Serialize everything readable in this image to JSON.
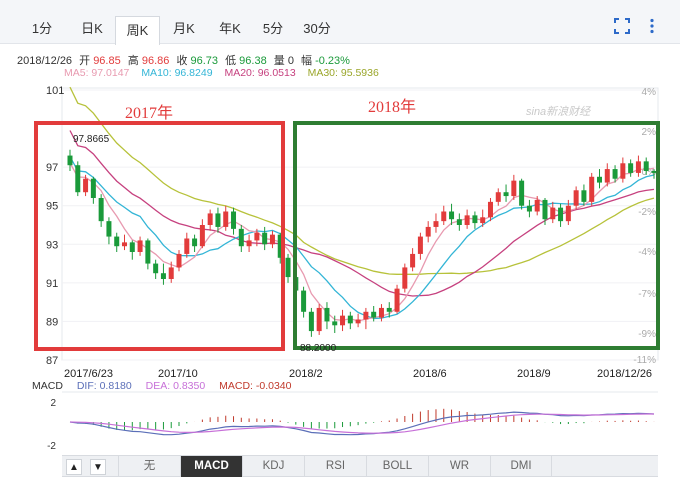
{
  "tabs": [
    {
      "label": "1分"
    },
    {
      "label": "日K"
    },
    {
      "label": "周K"
    },
    {
      "label": "月K"
    },
    {
      "label": "年K"
    },
    {
      "label": "5分"
    },
    {
      "label": "30分"
    }
  ],
  "active_tab": "周K",
  "toolbar_icons": [
    "fullscreen-icon",
    "more-vertical-icon"
  ],
  "quote": {
    "date": "2018/12/26",
    "open_label": "开",
    "open": "96.85",
    "high_label": "高",
    "high": "96.86",
    "close_label": "收",
    "close": "96.73",
    "low_label": "低",
    "low": "96.38",
    "volume_label": "量",
    "volume": "0",
    "change_label": "幅",
    "change": "-0.23%"
  },
  "ma": {
    "ma5": "MA5: 97.0147",
    "ma10": "MA10: 96.8249",
    "ma20": "MA20: 96.0513",
    "ma30": "MA30: 95.5936"
  },
  "colors": {
    "ma5": "#e89ab0",
    "ma10": "#33b5d6",
    "ma20": "#c6417f",
    "ma30": "#b7c23a",
    "up": "#e23b3b",
    "down": "#1a9a3a",
    "box2017": "#e23b3b",
    "box2018": "#2e7d32",
    "dif": "#5b6fb8",
    "dea": "#c770d8",
    "macd": "#c0392b"
  },
  "annotations": {
    "label_2017": "2017年",
    "label_2018": "2018年",
    "peak_marker": "97.8665",
    "low_marker": "88.2000",
    "watermark": "sina新浪财经"
  },
  "chart_data": {
    "type": "candlestick",
    "ylim": [
      87,
      101
    ],
    "left_axis_ticks": [
      "101",
      "97",
      "95",
      "93",
      "91",
      "89",
      "87"
    ],
    "right_axis_ticks": [
      "4%",
      "2%",
      "0%",
      "-2%",
      "-4%",
      "-7%",
      "-9%",
      "-11%"
    ],
    "x_labels": [
      "2017/6/23",
      "2017/10",
      "2018/2",
      "2018/6",
      "2018/9",
      "2018/12/26"
    ],
    "candles": [
      [
        97.6,
        97.1,
        97.9,
        96.8
      ],
      [
        97.1,
        95.7,
        97.3,
        95.5
      ],
      [
        95.7,
        96.4,
        96.6,
        95.5
      ],
      [
        96.4,
        95.4,
        96.5,
        95.1
      ],
      [
        95.4,
        94.2,
        95.6,
        93.9
      ],
      [
        94.2,
        93.4,
        94.4,
        93.0
      ],
      [
        93.4,
        92.9,
        93.6,
        92.6
      ],
      [
        92.9,
        93.1,
        93.5,
        92.7
      ],
      [
        93.1,
        92.6,
        93.2,
        92.2
      ],
      [
        92.6,
        93.2,
        93.4,
        92.4
      ],
      [
        93.2,
        92.0,
        93.3,
        91.7
      ],
      [
        92.0,
        91.5,
        92.2,
        91.2
      ],
      [
        91.5,
        91.2,
        92.0,
        90.9
      ],
      [
        91.2,
        91.8,
        92.1,
        91.0
      ],
      [
        91.8,
        92.5,
        92.7,
        91.6
      ],
      [
        92.5,
        93.3,
        93.6,
        92.3
      ],
      [
        93.3,
        92.9,
        93.5,
        92.6
      ],
      [
        92.9,
        94.0,
        94.3,
        92.8
      ],
      [
        94.0,
        94.6,
        94.8,
        93.7
      ],
      [
        94.6,
        93.9,
        94.9,
        93.6
      ],
      [
        93.9,
        94.7,
        95.0,
        93.7
      ],
      [
        94.7,
        93.8,
        94.9,
        93.5
      ],
      [
        93.8,
        92.9,
        94.0,
        92.6
      ],
      [
        92.9,
        93.2,
        93.5,
        92.6
      ],
      [
        93.2,
        93.6,
        93.8,
        92.9
      ],
      [
        93.6,
        93.0,
        93.9,
        92.7
      ],
      [
        93.0,
        93.5,
        93.7,
        92.8
      ],
      [
        93.5,
        92.3,
        93.6,
        92.0
      ],
      [
        92.3,
        91.3,
        92.5,
        91.0
      ],
      [
        91.3,
        90.6,
        91.6,
        90.2
      ],
      [
        90.6,
        89.5,
        90.8,
        89.2
      ],
      [
        89.5,
        88.5,
        89.7,
        88.2
      ],
      [
        88.5,
        89.7,
        89.9,
        88.3
      ],
      [
        89.7,
        89.0,
        90.0,
        88.6
      ],
      [
        89.0,
        88.8,
        89.3,
        88.4
      ],
      [
        88.8,
        89.3,
        89.6,
        88.5
      ],
      [
        89.3,
        88.9,
        89.5,
        88.6
      ],
      [
        88.9,
        89.1,
        89.4,
        88.7
      ],
      [
        89.1,
        89.5,
        89.7,
        88.6
      ],
      [
        89.5,
        89.2,
        89.8,
        89.0
      ],
      [
        89.2,
        89.7,
        89.9,
        89.0
      ],
      [
        89.7,
        89.5,
        90.0,
        89.2
      ],
      [
        89.5,
        90.7,
        90.9,
        89.4
      ],
      [
        90.7,
        91.8,
        92.0,
        90.5
      ],
      [
        91.8,
        92.5,
        92.8,
        91.6
      ],
      [
        92.5,
        93.4,
        93.6,
        92.2
      ],
      [
        93.4,
        93.9,
        94.2,
        93.1
      ],
      [
        93.9,
        94.2,
        94.6,
        93.6
      ],
      [
        94.2,
        94.7,
        95.0,
        94.0
      ],
      [
        94.7,
        94.3,
        95.1,
        94.0
      ],
      [
        94.3,
        94.0,
        94.6,
        93.7
      ],
      [
        94.0,
        94.5,
        94.8,
        93.8
      ],
      [
        94.5,
        94.1,
        94.7,
        93.8
      ],
      [
        94.1,
        94.4,
        94.8,
        93.9
      ],
      [
        94.4,
        95.2,
        95.4,
        94.2
      ],
      [
        95.2,
        95.7,
        95.9,
        95.0
      ],
      [
        95.7,
        95.5,
        96.1,
        95.2
      ],
      [
        95.5,
        96.3,
        96.6,
        95.3
      ],
      [
        96.3,
        95.0,
        96.4,
        94.8
      ],
      [
        95.0,
        94.7,
        95.3,
        94.4
      ],
      [
        94.7,
        95.3,
        95.5,
        94.5
      ],
      [
        95.3,
        94.3,
        95.4,
        94.0
      ],
      [
        94.3,
        94.9,
        95.2,
        94.1
      ],
      [
        94.9,
        94.2,
        95.1,
        93.9
      ],
      [
        94.2,
        95.0,
        95.3,
        94.0
      ],
      [
        95.0,
        95.8,
        96.0,
        94.8
      ],
      [
        95.8,
        95.2,
        96.1,
        95.0
      ],
      [
        95.2,
        96.5,
        96.7,
        95.0
      ],
      [
        96.5,
        96.2,
        96.9,
        95.9
      ],
      [
        96.2,
        96.9,
        97.2,
        96.0
      ],
      [
        96.9,
        96.4,
        97.1,
        96.2
      ],
      [
        96.4,
        97.2,
        97.5,
        96.2
      ],
      [
        97.2,
        96.7,
        97.4,
        96.5
      ],
      [
        96.7,
        97.3,
        97.6,
        96.5
      ],
      [
        97.3,
        96.8,
        97.5,
        96.6
      ],
      [
        96.8,
        96.7,
        96.9,
        96.4
      ]
    ],
    "macd_ticks": [
      "2",
      "-2"
    ]
  },
  "macd": {
    "title": "MACD",
    "dif": "DIF: 0.8180",
    "dea": "DEA: 0.8350",
    "macd": "MACD: -0.0340"
  },
  "indicators": [
    {
      "label": "无"
    },
    {
      "label": "MACD"
    },
    {
      "label": "KDJ"
    },
    {
      "label": "RSI"
    },
    {
      "label": "BOLL"
    },
    {
      "label": "WR"
    },
    {
      "label": "DMI"
    }
  ],
  "active_indicator": "MACD",
  "nav": {
    "up": "▲",
    "down": "▼"
  }
}
